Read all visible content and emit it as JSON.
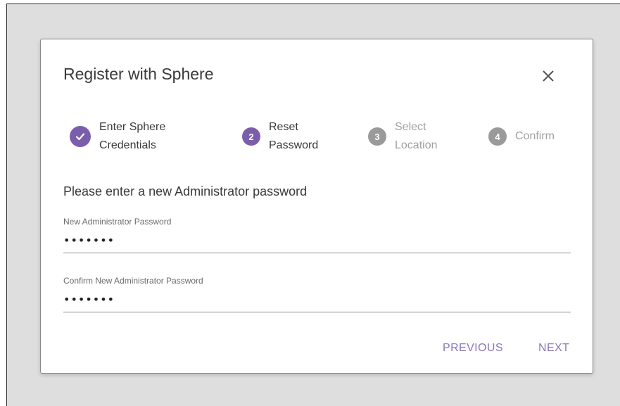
{
  "dialog": {
    "title": "Register with Sphere",
    "close_icon": "close-icon"
  },
  "stepper": {
    "steps": [
      {
        "number": "",
        "label": "Enter Sphere\nCredentials",
        "state": "completed",
        "icon": "check-icon"
      },
      {
        "number": "2",
        "label": "Reset\nPassword",
        "state": "active"
      },
      {
        "number": "3",
        "label": "Select\nLocation",
        "state": "inactive"
      },
      {
        "number": "4",
        "label": "Confirm",
        "state": "inactive"
      }
    ]
  },
  "form": {
    "instruction": "Please enter a new Administrator password",
    "new_password": {
      "label": "New Administrator Password",
      "value": "1234567"
    },
    "confirm_password": {
      "label": "Confirm New Administrator Password",
      "value": "1234567"
    }
  },
  "actions": {
    "previous_label": "PREVIOUS",
    "next_label": "NEXT"
  },
  "colors": {
    "accent": "#7b5eab",
    "button_text": "#8a76b8",
    "inactive_step": "#9a9a9a",
    "backdrop": "#dedede"
  }
}
